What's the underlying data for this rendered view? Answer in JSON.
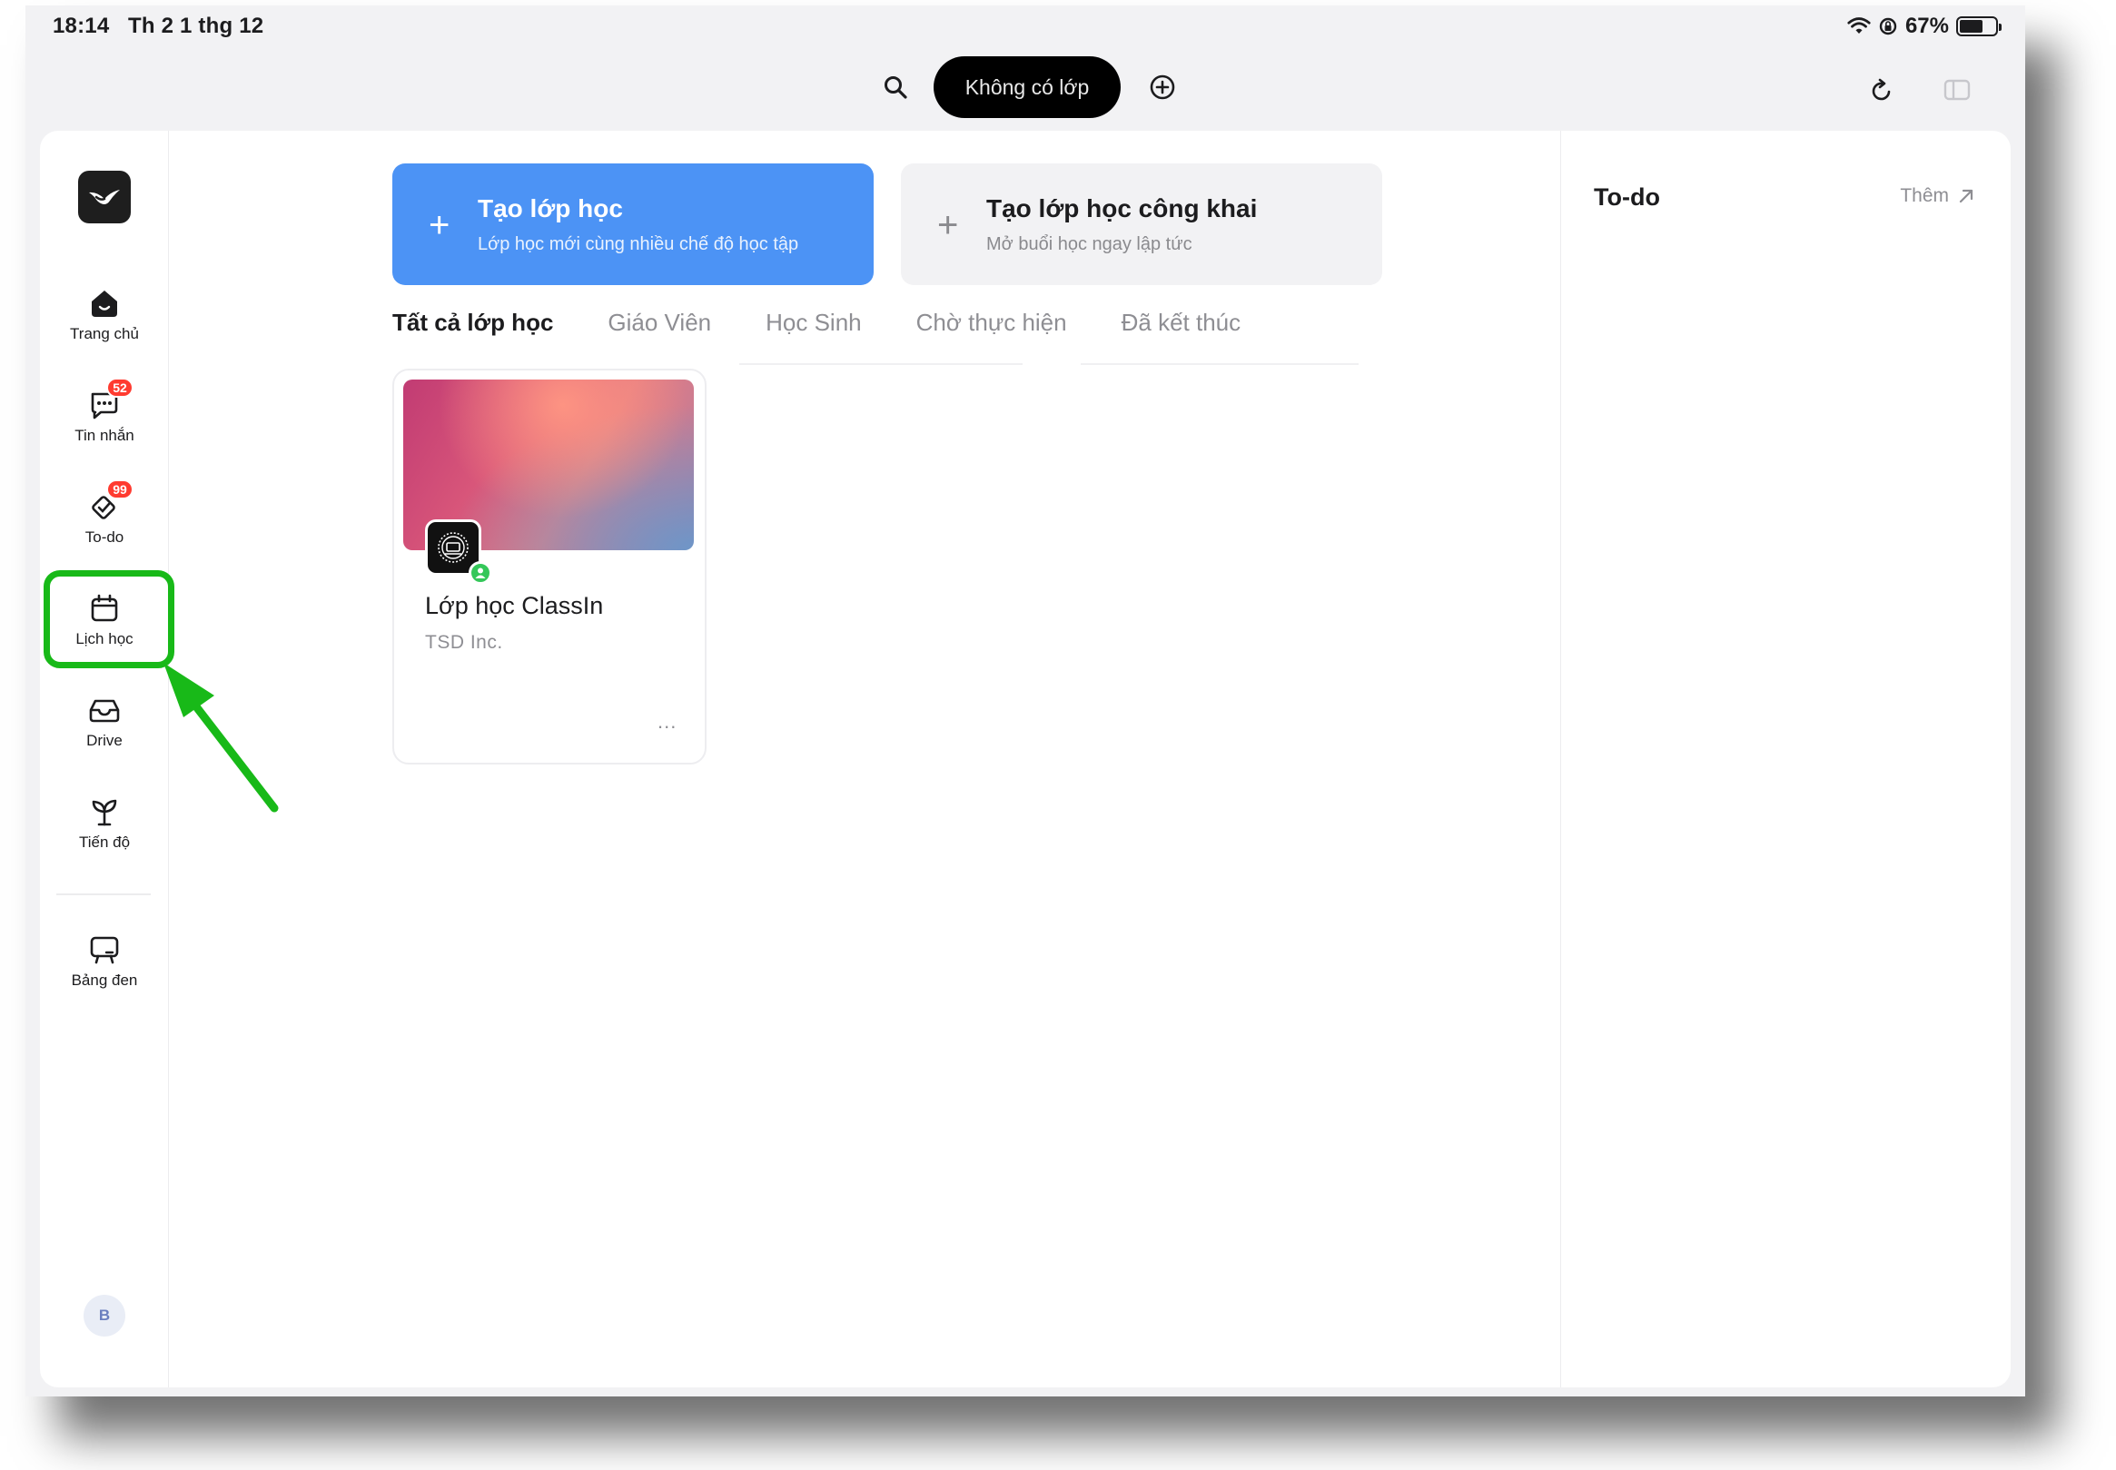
{
  "status_bar": {
    "time": "18:14",
    "date": "Th 2 1 thg 12",
    "battery": "67%",
    "battery_level": 0.67
  },
  "toolbar": {
    "class_selector": "Không có lớp",
    "icons": [
      "search-icon",
      "add-circle-icon",
      "refresh-icon",
      "sidebar-panel-icon"
    ]
  },
  "sidebar": {
    "logo": "classin-logo",
    "items": [
      {
        "label": "Trang chủ",
        "icon": "home-icon"
      },
      {
        "label": "Tin nhắn",
        "icon": "chat-icon",
        "badge": "52"
      },
      {
        "label": "To-do",
        "icon": "todo-icon",
        "badge": "99"
      },
      {
        "label": "Lịch học",
        "icon": "calendar-icon"
      },
      {
        "label": "Drive",
        "icon": "drive-icon"
      },
      {
        "label": "Tiến độ",
        "icon": "progress-sprout-icon"
      },
      {
        "label": "Bảng đen",
        "icon": "blackboard-icon"
      }
    ],
    "avatar": "B"
  },
  "actions": {
    "create": {
      "title": "Tạo lớp học",
      "subtitle": "Lớp học mới cùng nhiều chế độ học tập"
    },
    "public": {
      "title": "Tạo lớp học công khai",
      "subtitle": "Mở buổi học ngay lập tức"
    }
  },
  "tabs": [
    "Tất cả lớp học",
    "Giáo Viên",
    "Học Sinh",
    "Chờ thực hiện",
    "Đã kết thúc"
  ],
  "active_tab": "Tất cả lớp học",
  "classes": [
    {
      "name": "Lớp học ClassIn",
      "org": "TSD Inc.",
      "more": "..."
    }
  ],
  "right_panel": {
    "title": "To-do",
    "more": "Thêm"
  },
  "colors": {
    "accent": "#4c93f5",
    "badge": "#ff3b30",
    "online": "#34c759",
    "annotation": "#18b918"
  }
}
